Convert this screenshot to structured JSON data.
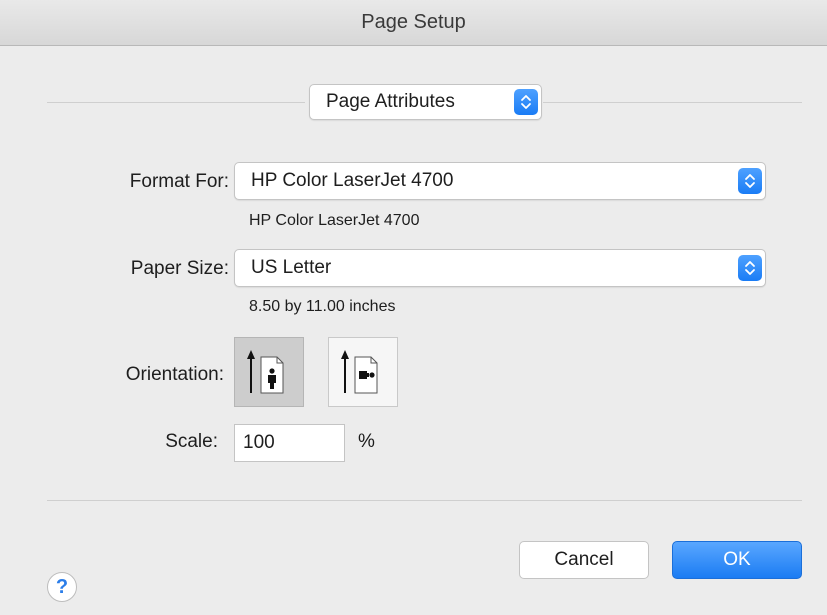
{
  "window": {
    "title": "Page Setup"
  },
  "settings_popup": {
    "value": "Page Attributes"
  },
  "format_for": {
    "label": "Format For:",
    "value": "HP Color LaserJet 4700",
    "description": "HP Color LaserJet 4700"
  },
  "paper_size": {
    "label": "Paper Size:",
    "value": "US Letter",
    "description": "8.50 by 11.00 inches"
  },
  "orientation": {
    "label": "Orientation:",
    "options": [
      "portrait",
      "landscape"
    ],
    "selected": "portrait"
  },
  "scale": {
    "label": "Scale:",
    "value": "100",
    "unit": "%"
  },
  "buttons": {
    "help": "?",
    "cancel": "Cancel",
    "ok": "OK"
  },
  "colors": {
    "accent": "#1a7cf5",
    "window_bg": "#ececec"
  },
  "icons": {
    "stepper": "up-down-chevron-icon",
    "portrait": "portrait-orientation-icon",
    "landscape": "landscape-orientation-icon",
    "help": "question-mark-icon"
  }
}
